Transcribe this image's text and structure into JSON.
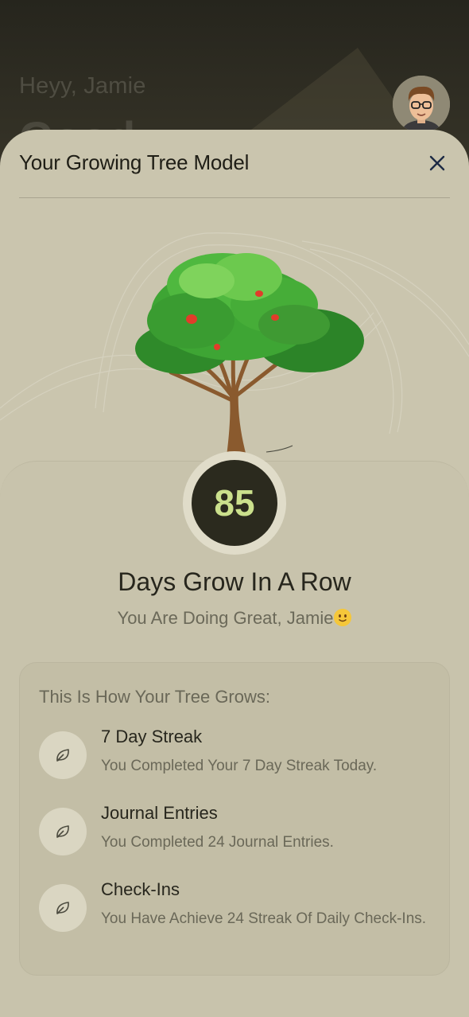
{
  "background": {
    "greeting": "Heyy, Jamie",
    "headline_partial": "Good"
  },
  "sheet": {
    "title": "Your Growing Tree Model",
    "close_icon": "close-icon"
  },
  "streak": {
    "count": "85",
    "title": "Days Grow In A Row",
    "subtitle": "You Are Doing Great, Jamie"
  },
  "growth": {
    "heading": "This Is How Your Tree Grows:",
    "items": [
      {
        "title": "7 Day Streak",
        "description": "You Completed Your 7 Day Streak Today.",
        "icon": "leaf-icon"
      },
      {
        "title": "Journal Entries",
        "description": "You Completed 24 Journal Entries.",
        "icon": "leaf-icon"
      },
      {
        "title": "Check-Ins",
        "description": "You Have Achieve 24  Streak Of Daily Check-Ins.",
        "icon": "leaf-icon"
      }
    ]
  },
  "colors": {
    "sheet_bg": "#cac5ae",
    "count_circle": "#2b2a1e",
    "count_text": "#cbe08c"
  }
}
